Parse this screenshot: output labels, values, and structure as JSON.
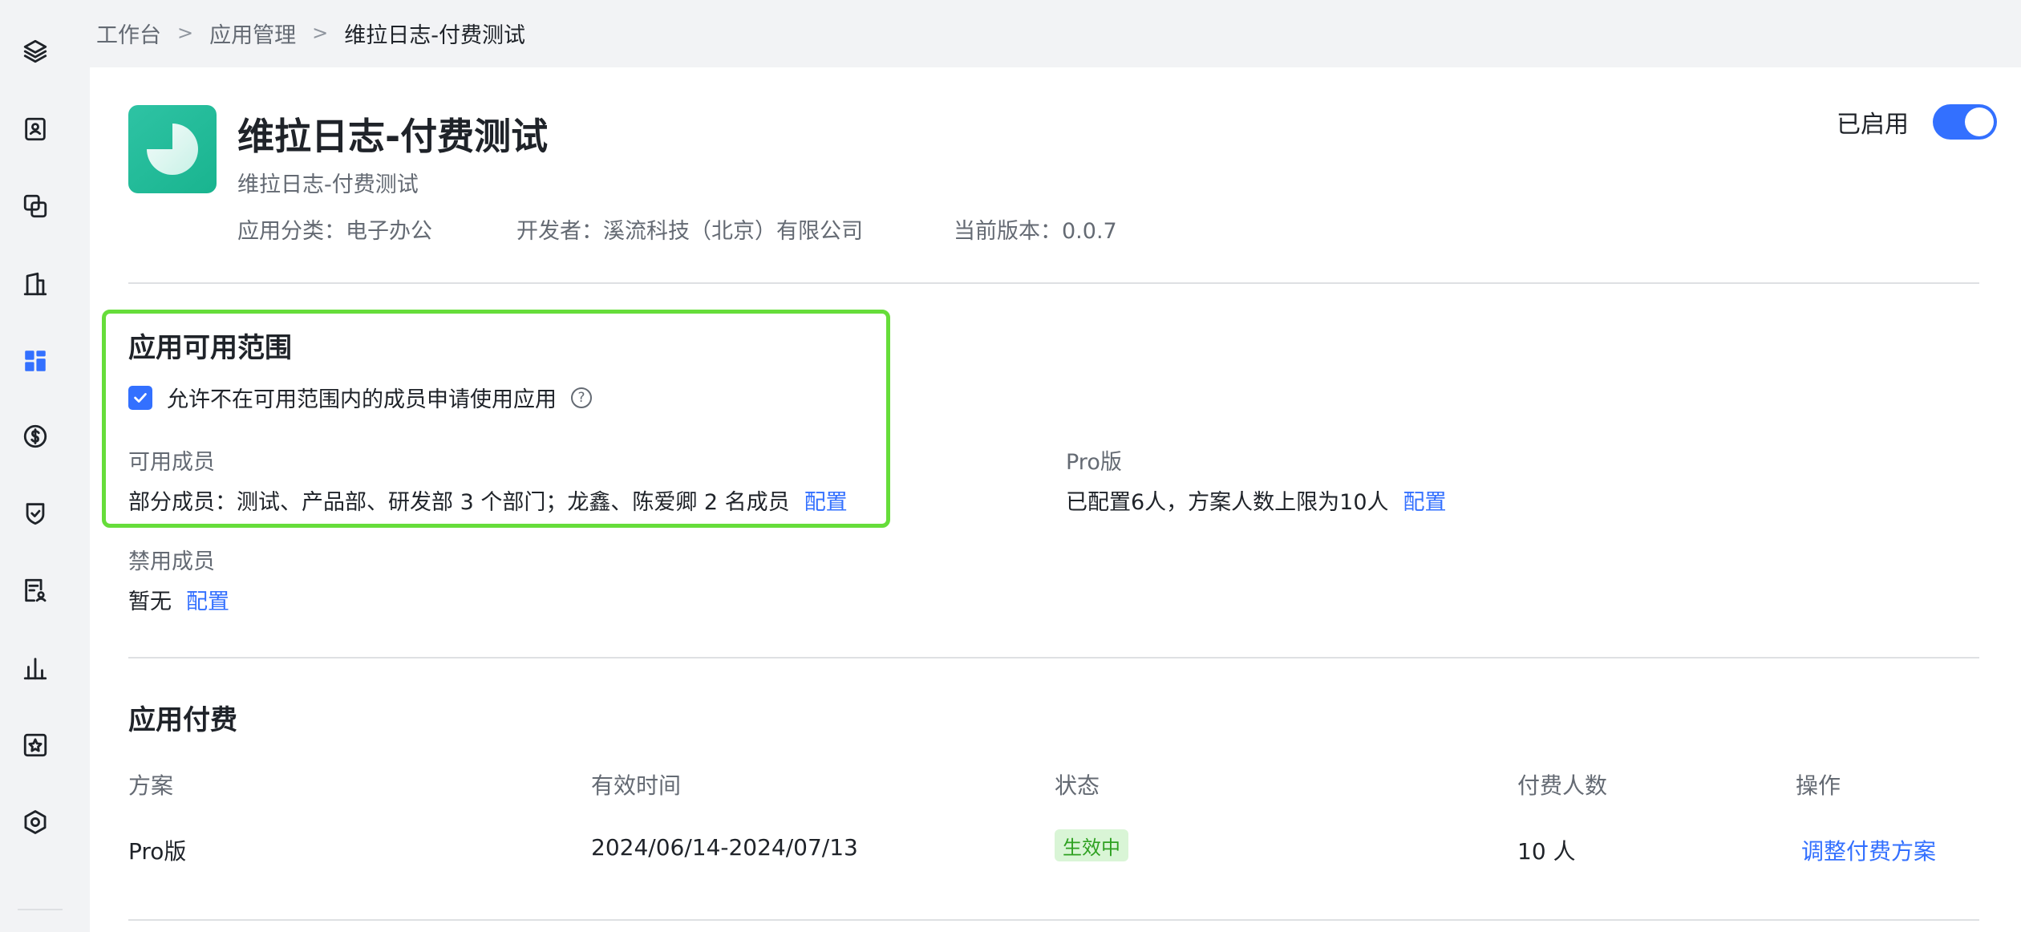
{
  "breadcrumb": {
    "items": [
      "工作台",
      "应用管理",
      "维拉日志-付费测试"
    ],
    "separator": ">"
  },
  "sidebar": {
    "icons": [
      "layers-icon",
      "contacts-icon",
      "copy-icon",
      "building-icon",
      "apps-grid-icon",
      "dollar-icon",
      "shield-check-icon",
      "user-doc-icon",
      "bar-chart-icon",
      "star-box-icon",
      "settings-hex-icon"
    ],
    "active": "apps-grid-icon",
    "accent": "#3370ff"
  },
  "app": {
    "name": "维拉日志-付费测试",
    "subtitle": "维拉日志-付费测试",
    "category": "应用分类：电子办公",
    "developer": "开发者：溪流科技（北京）有限公司",
    "version": "当前版本：0.0.7",
    "status_label": "已启用",
    "enabled": true,
    "logo_color": "#1dbb96"
  },
  "scope": {
    "title": "应用可用范围",
    "allow_apply_label": "允许不在可用范围内的成员申请使用应用",
    "allow_apply_checked": true,
    "available_label": "可用成员",
    "available_value": "部分成员：测试、产品部、研发部 3 个部门；龙鑫、陈爱卿 2 名成员",
    "pro_label": "Pro版",
    "pro_value": "已配置6人，方案人数上限为10人",
    "banned_label": "禁用成员",
    "banned_value": "暂无",
    "config_link": "配置",
    "highlight_color": "#66dd3a"
  },
  "billing": {
    "title": "应用付费",
    "columns": [
      "方案",
      "有效时间",
      "状态",
      "付费人数",
      "操作"
    ],
    "rows": [
      {
        "plan": "Pro版",
        "period": "2024/06/14-2024/07/13",
        "status": "生效中",
        "count": "10 人",
        "action": "调整付费方案"
      }
    ],
    "status_color": "#2ea121"
  }
}
